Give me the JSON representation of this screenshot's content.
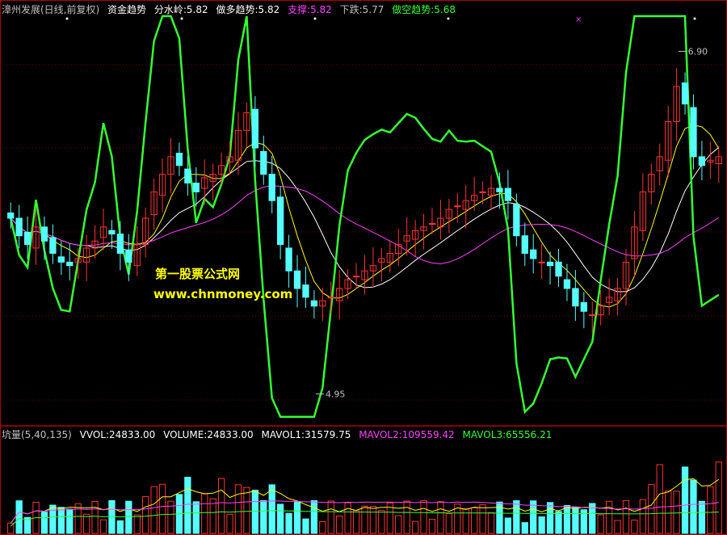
{
  "header": {
    "title": "漳州发展(日线,前复权)",
    "indicator_name": "资金趋势",
    "fenshuiling": "分水岭:5.82",
    "zuoduo": "做多趋势:5.82",
    "zhicheng": "支撑:5.82",
    "xiadie": "下跌:5.77",
    "zuokong": "做空趋势:5.68"
  },
  "volume_header": {
    "name": "坑量(5,40,135)",
    "vvol": "VVOL:24833.00",
    "volume": "VOLUME:24833.00",
    "mavol1": "MAVOL1:31579.75",
    "mavol2": "MAVOL2:109559.42",
    "mavol3": "MAVOL3:65556.21"
  },
  "watermark": {
    "line1": "第一股票公式网",
    "line2": "www.chnmoney.com"
  },
  "colors": {
    "up": "#ff3232",
    "down": "#54ffff",
    "ma_white": "#ffffff",
    "ma_magenta": "#ff40ff",
    "ma_yellow": "#ffff00",
    "trend_green": "#33ff33",
    "frame": "#b00000",
    "watermark": "#ffff00"
  },
  "chart_data": {
    "type": "candlestick",
    "price_range": [
      4.8,
      7.1
    ],
    "annotations": [
      {
        "text": "6.90",
        "value": 6.9,
        "kind": "high"
      },
      {
        "text": "4.95",
        "value": 4.95,
        "kind": "low"
      }
    ],
    "closes": [
      5.95,
      5.85,
      5.8,
      5.9,
      5.82,
      5.75,
      5.7,
      5.68,
      5.72,
      5.78,
      5.82,
      5.9,
      5.86,
      5.75,
      5.7,
      5.8,
      5.95,
      6.1,
      6.2,
      6.3,
      6.25,
      6.15,
      6.1,
      6.18,
      6.2,
      6.25,
      6.3,
      6.45,
      6.55,
      6.35,
      6.2,
      6.05,
      5.8,
      5.65,
      5.55,
      5.5,
      5.45,
      5.48,
      5.5,
      5.55,
      5.6,
      5.62,
      5.65,
      5.68,
      5.72,
      5.75,
      5.8,
      5.85,
      5.88,
      5.9,
      5.92,
      5.95,
      6.0,
      6.02,
      6.05,
      6.08,
      6.1,
      6.12,
      6.1,
      6.05,
      5.85,
      5.75,
      5.72,
      5.7,
      5.68,
      5.62,
      5.55,
      5.45,
      5.42,
      5.4,
      5.45,
      5.5,
      5.55,
      5.7,
      5.9,
      6.1,
      6.2,
      6.3,
      6.5,
      6.7,
      6.6,
      6.3,
      6.25,
      6.28,
      6.3
    ],
    "volume_range": [
      0,
      160000
    ]
  }
}
